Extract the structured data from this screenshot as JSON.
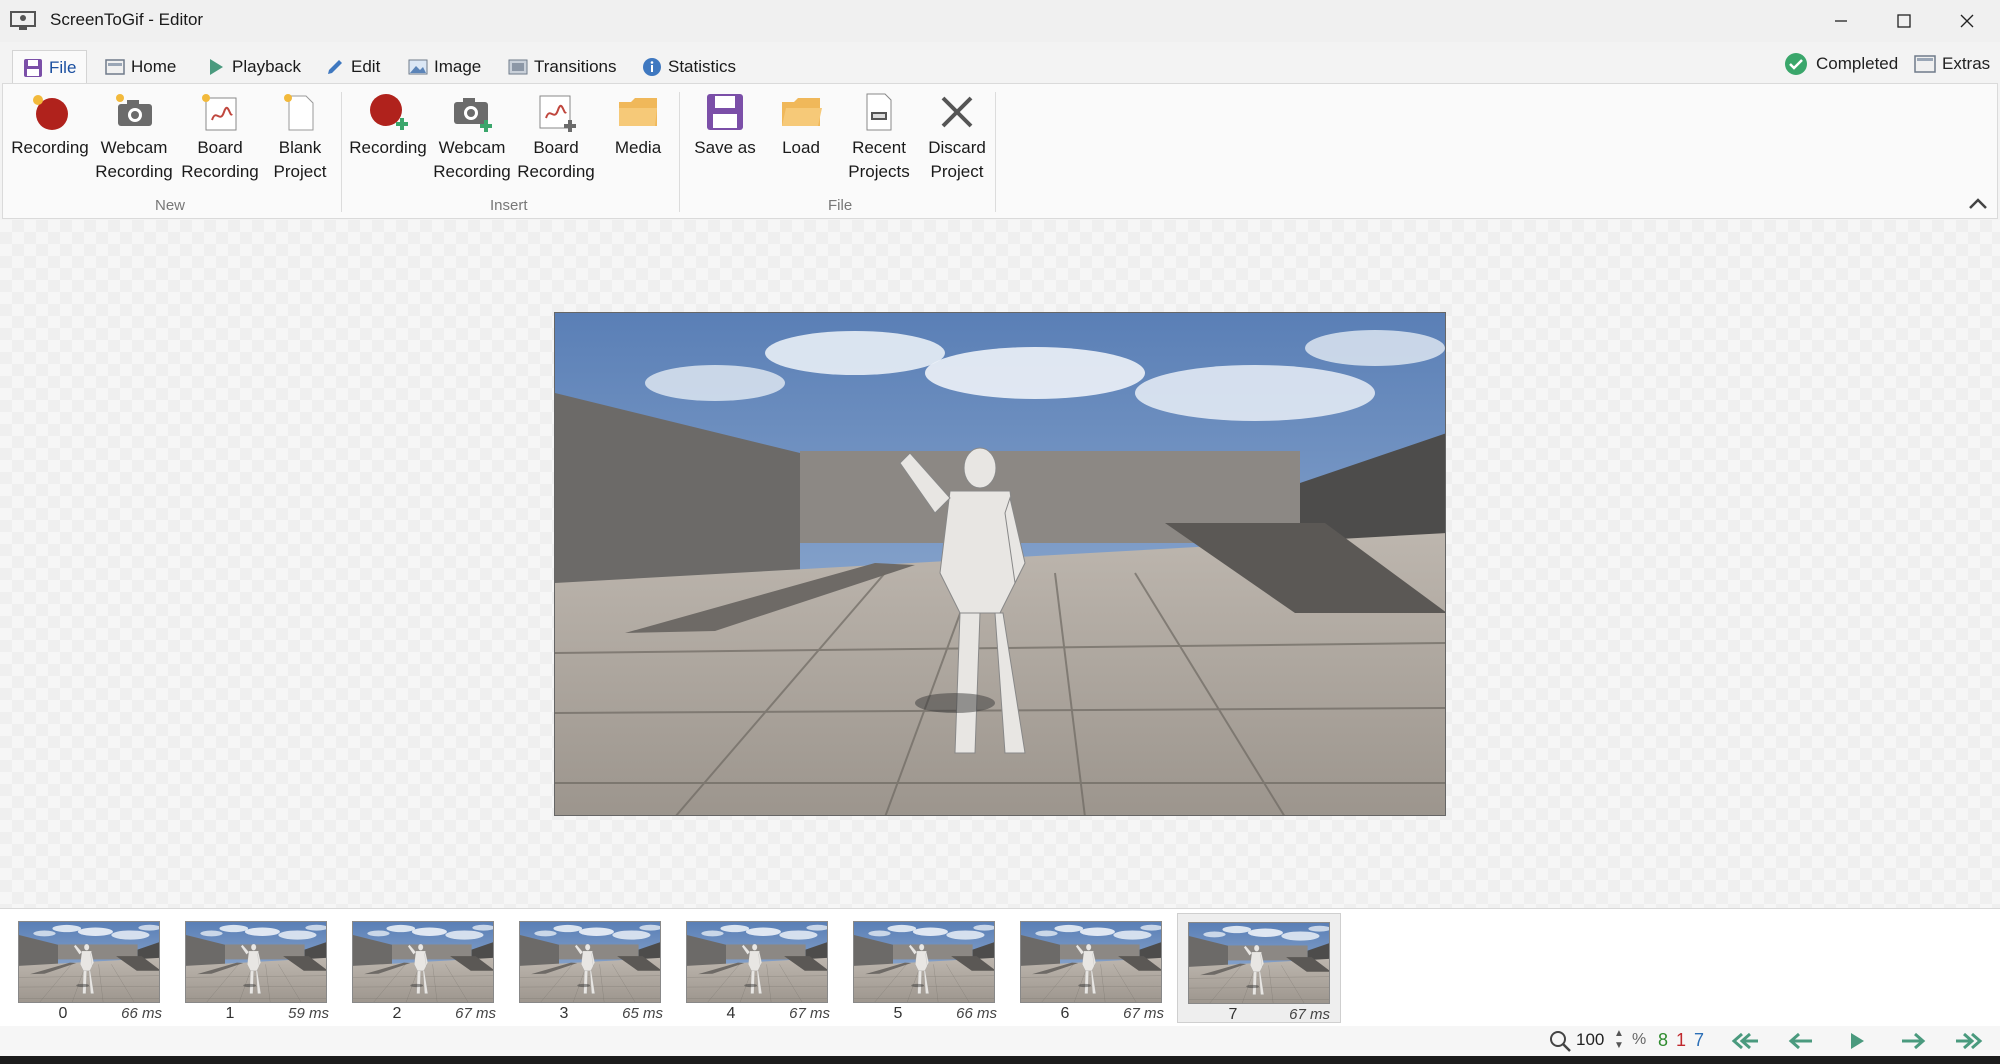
{
  "window": {
    "title": "ScreenToGif - Editor"
  },
  "tabs": [
    {
      "label": "File",
      "icon": "floppy-icon"
    },
    {
      "label": "Home",
      "icon": "home-icon"
    },
    {
      "label": "Playback",
      "icon": "play-icon"
    },
    {
      "label": "Edit",
      "icon": "pencil-icon"
    },
    {
      "label": "Image",
      "icon": "image-icon"
    },
    {
      "label": "Transitions",
      "icon": "transitions-icon"
    },
    {
      "label": "Statistics",
      "icon": "info-icon"
    }
  ],
  "active_tab": "File",
  "status": {
    "completed_label": "Completed",
    "extras_label": "Extras"
  },
  "ribbon": {
    "groups": [
      {
        "label": "New"
      },
      {
        "label": "Insert"
      },
      {
        "label": "File"
      }
    ],
    "new": {
      "recording": [
        "Recording",
        ""
      ],
      "webcam": [
        "Webcam",
        "Recording"
      ],
      "board": [
        "Board",
        "Recording"
      ],
      "blank": [
        "Blank",
        "Project"
      ]
    },
    "insert": {
      "recording": [
        "Recording",
        ""
      ],
      "webcam": [
        "Webcam",
        "Recording"
      ],
      "board": [
        "Board",
        "Recording"
      ],
      "media": [
        "Media",
        ""
      ]
    },
    "file": {
      "save_as": [
        "Save as",
        ""
      ],
      "load": [
        "Load",
        ""
      ],
      "recent": [
        "Recent",
        "Projects"
      ],
      "discard": [
        "Discard",
        "Project"
      ]
    }
  },
  "frames": [
    {
      "index": "0",
      "duration": "66 ms"
    },
    {
      "index": "1",
      "duration": "59 ms"
    },
    {
      "index": "2",
      "duration": "67 ms"
    },
    {
      "index": "3",
      "duration": "65 ms"
    },
    {
      "index": "4",
      "duration": "67 ms"
    },
    {
      "index": "5",
      "duration": "66 ms"
    },
    {
      "index": "6",
      "duration": "67 ms"
    },
    {
      "index": "7",
      "duration": "67 ms"
    }
  ],
  "selected_frame": "7",
  "statusbar": {
    "zoom": "100",
    "zoom_unit": "%",
    "total_frames": "8",
    "selected_count": "1",
    "current_frame": "7"
  },
  "colors": {
    "accent_blue": "#1a4fa0",
    "completed_green": "#3aa66b",
    "nav_green": "#4a9a7e",
    "record_red": "#b0221c",
    "save_purple": "#7b4fa8",
    "folder_orange": "#f0b85a",
    "count_green": "#2e8b2e",
    "count_red": "#c0282d",
    "count_blue": "#2c6fb7"
  }
}
